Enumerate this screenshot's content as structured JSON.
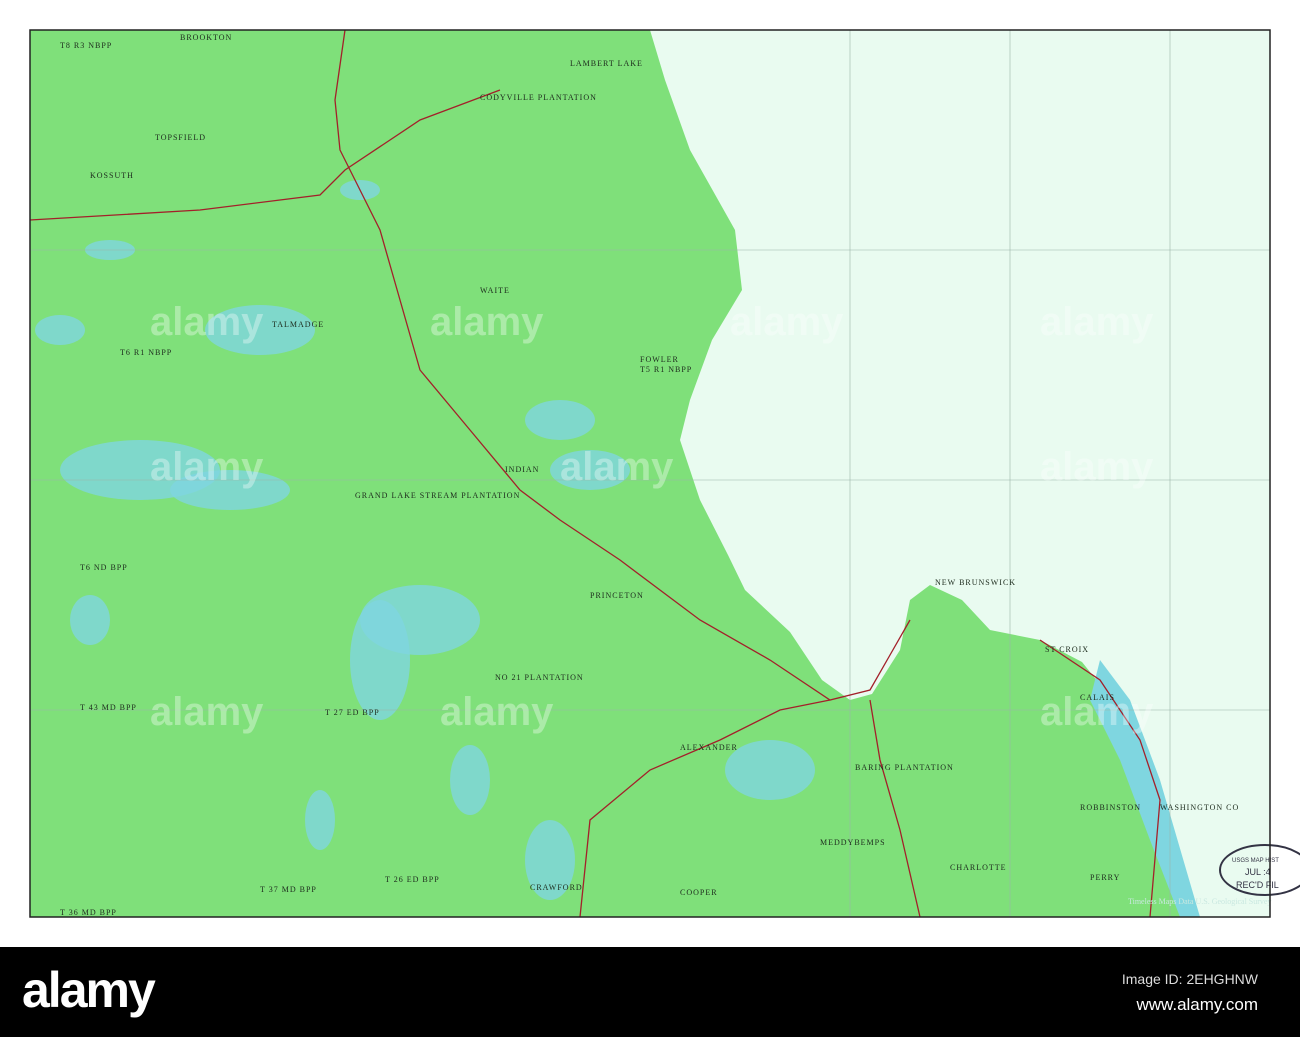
{
  "map": {
    "colors": {
      "land": "#7fe07a",
      "water": "#e9fbf0",
      "lake": "#7fd6e0",
      "road": "#a3202a",
      "grid": "#9ab4a8"
    },
    "labels": [
      "BROOKTON",
      "T8 R3 NBPP",
      "LAMBERT LAKE",
      "CODYVILLE PLANTATION",
      "TOPSFIELD",
      "KOSSUTH",
      "WAITE",
      "TALMADGE",
      "T6 R1 NBPP",
      "FOWLER",
      "T5 R1 NBPP",
      "INDIAN",
      "GRAND LAKE STREAM PLANTATION",
      "T6 ND BPP",
      "PRINCETON",
      "NO 21 PLANTATION",
      "T 43 MD BPP",
      "T 27 ED BPP",
      "ALEXANDER",
      "BARING PLANTATION",
      "CALAIS",
      "ROBBINSTON",
      "MEDDYBEMPS",
      "CRAWFORD",
      "COOPER",
      "CHARLOTTE",
      "PERRY",
      "T 37 MD BPP",
      "T 36 MD BPP",
      "T 26 ED BPP",
      "NEW BRUNSWICK",
      "ST CROIX",
      "WASHINGTON CO"
    ],
    "stamp": {
      "line1": "USGS MAP HIST",
      "line2": "JUL :4",
      "line3": "REC'D FIL"
    },
    "credit": "Timeless Maps Data U.S. Geological Survey",
    "watermark": "alamy"
  },
  "footer": {
    "logo": "alamy",
    "image_id": "Image ID: 2EHGHNW",
    "site": "www.alamy.com"
  }
}
